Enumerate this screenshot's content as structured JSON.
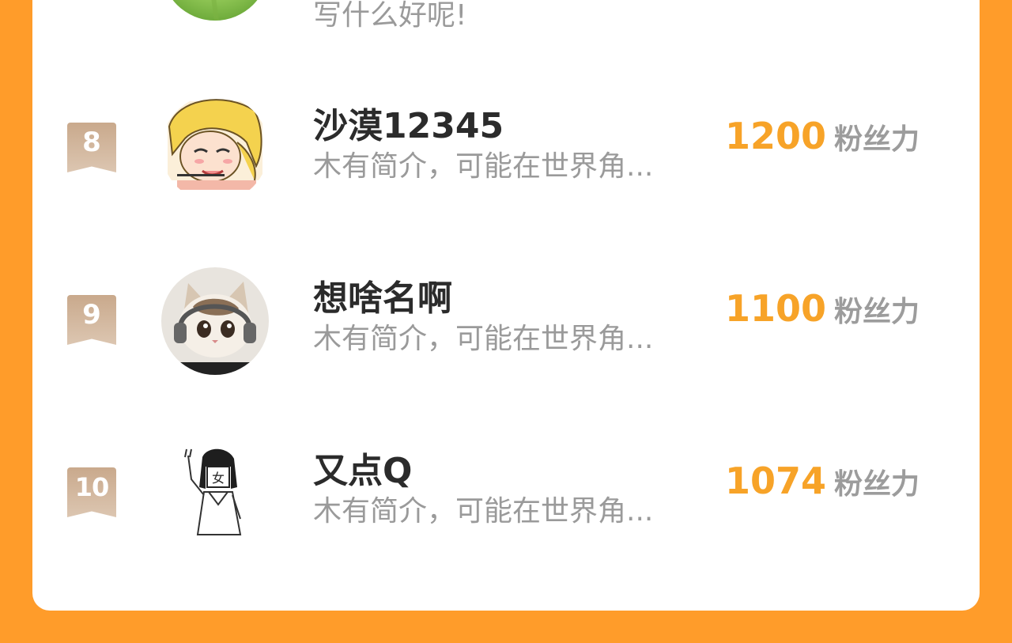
{
  "partial_top": {
    "desc": "写什么好呢!"
  },
  "ranking": [
    {
      "rank": "8",
      "name": "沙漠12345",
      "desc": "木有简介，可能在世界角...",
      "fans": "1200",
      "unit": "粉丝力",
      "avatar_icon": "anime-blonde-avatar"
    },
    {
      "rank": "9",
      "name": "想啥名啊",
      "desc": "木有简介，可能在世界角...",
      "fans": "1100",
      "unit": "粉丝力",
      "avatar_icon": "cat-headphones-avatar"
    },
    {
      "rank": "10",
      "name": "又点Q",
      "desc": "木有简介，可能在世界角...",
      "fans": "1074",
      "unit": "粉丝力",
      "avatar_icon": "sketch-girl-avatar"
    }
  ],
  "colors": {
    "background": "#FF9C2A",
    "card": "#FFFFFF",
    "fans_number": "#F7A328",
    "rank_badge": "#C9A98C"
  }
}
